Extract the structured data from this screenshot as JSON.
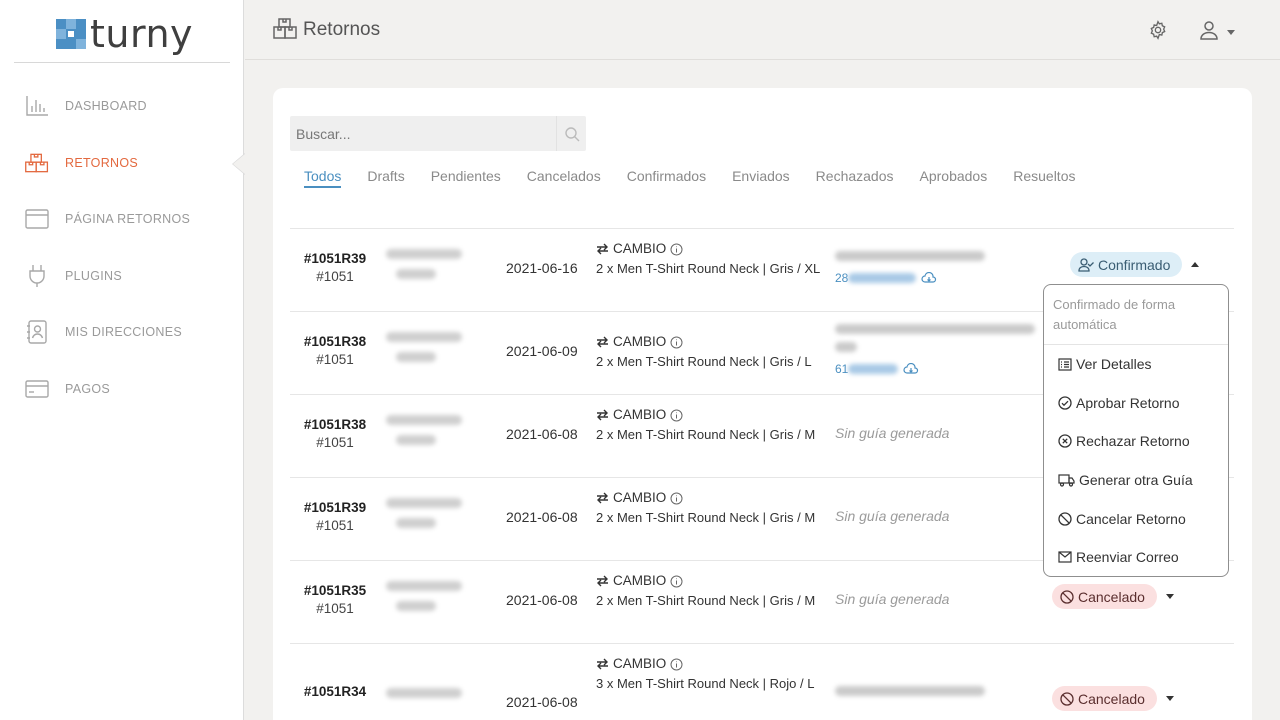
{
  "brand": {
    "name": "turny"
  },
  "sidebar": {
    "items": [
      {
        "label": "DASHBOARD",
        "icon": "bar-chart-icon",
        "active": false
      },
      {
        "label": "RETORNOS",
        "icon": "boxes-icon",
        "active": true
      },
      {
        "label": "PÁGINA RETORNOS",
        "icon": "browser-window-icon",
        "active": false
      },
      {
        "label": "PLUGINS",
        "icon": "plug-icon",
        "active": false
      },
      {
        "label": "MIS DIRECCIONES",
        "icon": "address-book-icon",
        "active": false
      },
      {
        "label": "PAGOS",
        "icon": "credit-card-icon",
        "active": false
      }
    ]
  },
  "header": {
    "title": "Retornos"
  },
  "search": {
    "placeholder": "Buscar..."
  },
  "tabs": [
    "Todos",
    "Drafts",
    "Pendientes",
    "Cancelados",
    "Confirmados",
    "Enviados",
    "Rechazados",
    "Aprobados",
    "Resueltos"
  ],
  "rows": [
    {
      "return_id": "#1051R39",
      "order_id": "#1051",
      "date": "2021-06-16",
      "type": "CAMBIO",
      "product": "2 x Men T-Shirt Round Neck | Gris / XL",
      "guide": "28",
      "status": "Confirmado"
    },
    {
      "return_id": "#1051R38",
      "order_id": "#1051",
      "date": "2021-06-09",
      "type": "CAMBIO",
      "product": "2 x Men T-Shirt Round Neck | Gris / L",
      "guide": "61",
      "status": ""
    },
    {
      "return_id": "#1051R38",
      "order_id": "#1051",
      "date": "2021-06-08",
      "type": "CAMBIO",
      "product": "2 x Men T-Shirt Round Neck | Gris / M",
      "guide": "Sin guía generada",
      "status": ""
    },
    {
      "return_id": "#1051R39",
      "order_id": "#1051",
      "date": "2021-06-08",
      "type": "CAMBIO",
      "product": "2 x Men T-Shirt Round Neck | Gris / M",
      "guide": "Sin guía generada",
      "status": ""
    },
    {
      "return_id": "#1051R35",
      "order_id": "#1051",
      "date": "2021-06-08",
      "type": "CAMBIO",
      "product": "2 x Men T-Shirt Round Neck | Gris / M",
      "guide": "Sin guía generada",
      "status": "Cancelado"
    },
    {
      "return_id": "#1051R34",
      "order_id": "",
      "date": "2021-06-08",
      "type": "CAMBIO",
      "product": "3 x Men T-Shirt Round Neck | Rojo / L",
      "guide": "",
      "status": "Cancelado"
    }
  ],
  "dropdown": {
    "header": "Confirmado de forma automática",
    "items": [
      {
        "label": "Ver Detalles",
        "icon": "list-icon"
      },
      {
        "label": "Aprobar Retorno",
        "icon": "check-circle-icon"
      },
      {
        "label": "Rechazar Retorno",
        "icon": "x-circle-icon"
      },
      {
        "label": "Generar otra Guía",
        "icon": "truck-icon"
      },
      {
        "label": "Cancelar Retorno",
        "icon": "ban-icon"
      },
      {
        "label": "Reenviar Correo",
        "icon": "envelope-icon"
      }
    ]
  },
  "colors": {
    "accent": "#e3693f",
    "link": "#4a8fc0",
    "confirmed_bg": "#ddeef7",
    "cancelled_bg": "#fbe0e0",
    "logo_blue": "#4b8fc4"
  }
}
